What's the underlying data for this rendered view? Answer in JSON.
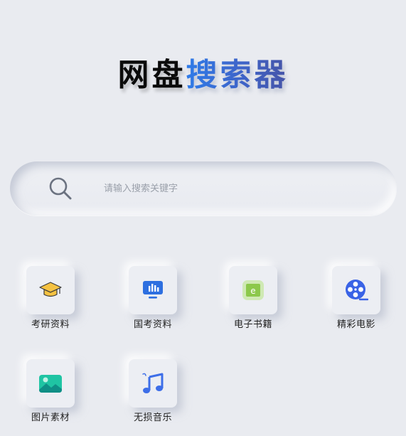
{
  "title": {
    "part1": "网盘",
    "part2": "搜索器"
  },
  "search": {
    "placeholder": "请输入搜索关键字",
    "value": ""
  },
  "categories": [
    {
      "label": "考研资料",
      "icon": "graduation-cap-icon"
    },
    {
      "label": "国考资料",
      "icon": "presentation-chart-icon"
    },
    {
      "label": "电子书籍",
      "icon": "ebook-icon"
    },
    {
      "label": "精彩电影",
      "icon": "film-reel-icon"
    },
    {
      "label": "图片素材",
      "icon": "image-icon"
    },
    {
      "label": "无损音乐",
      "icon": "music-note-icon"
    }
  ],
  "colors": {
    "background": "#e9ebf0",
    "title_dark": "#0b0b0b",
    "title_accent_start": "#2f7be8",
    "title_accent_end": "#4654a7",
    "cap_yellow": "#f5c242",
    "chart_blue": "#2d6fe0",
    "ebook_green": "#9bd15a",
    "film_blue": "#3a63e6",
    "image_teal": "#1fc4a3",
    "music_blue": "#3d6ee8"
  }
}
